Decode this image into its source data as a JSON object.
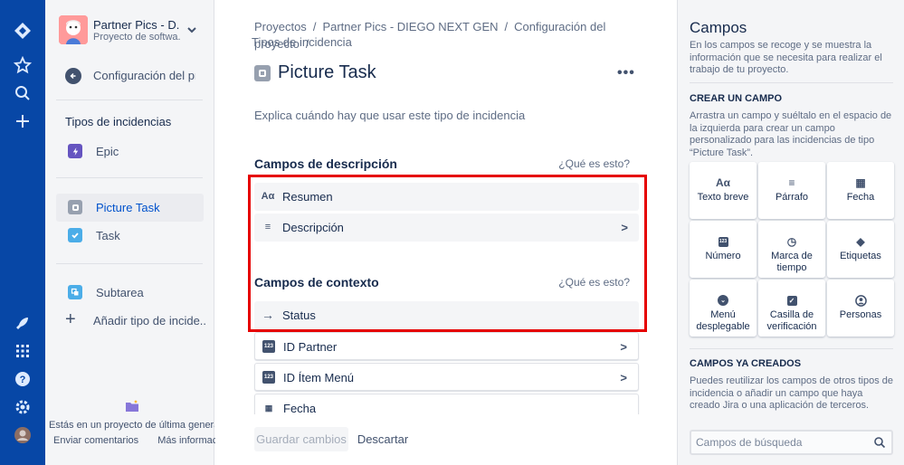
{
  "project": {
    "name": "Partner Pics - D...",
    "type": "Proyecto de softwa..."
  },
  "sidebar": {
    "back_label": "Configuración del pr...",
    "section_title": "Tipos de incidencias",
    "items": [
      {
        "label": "Epic",
        "icon": "epic-icon",
        "color": "#6554c0"
      },
      {
        "label": "Picture Task",
        "icon": "picture-task-icon",
        "color": "#97a0af",
        "active": true
      },
      {
        "label": "Task",
        "icon": "task-icon",
        "color": "#4bade8"
      },
      {
        "label": "Subtarea",
        "icon": "subtask-icon",
        "color": "#4bade8"
      }
    ],
    "add_type_label": "Añadir tipo de incide...",
    "next_gen_text": "Estás en un proyecto de última generación",
    "feedback_link": "Enviar comentarios",
    "more_info_link": "Más información"
  },
  "breadcrumbs": [
    "Proyectos",
    "Partner Pics - DIEGO NEXT GEN",
    "Configuración del proyecto",
    "Tipos de incidencia"
  ],
  "page": {
    "title": "Picture Task",
    "more_icon": "•••",
    "description_placeholder": "Explica cuándo hay que usar este tipo de incidencia"
  },
  "description_fields": {
    "title": "Campos de descripción",
    "help": "¿Qué es esto?",
    "fields": [
      {
        "label": "Resumen",
        "icon": "Aα"
      },
      {
        "label": "Descripción",
        "icon": "≡"
      }
    ]
  },
  "context_fields": {
    "title": "Campos de contexto",
    "help": "¿Qué es esto?",
    "fields": [
      {
        "label": "Status",
        "icon": "→"
      },
      {
        "label": "ID Partner",
        "icon": "123"
      },
      {
        "label": "ID Ítem Menú",
        "icon": "123"
      },
      {
        "label": "Fecha",
        "icon": "📅"
      }
    ]
  },
  "actions": {
    "save_label": "Guardar cambios",
    "cancel_label": "Descartar"
  },
  "right_panel": {
    "title": "Campos",
    "description": "En los campos se recoge y se muestra la información que se necesita para realizar el trabajo de tu proyecto.",
    "create_title": "CREAR UN CAMPO",
    "create_desc": "Arrastra un campo y suéltalo en el espacio de la izquierda para crear un campo personalizado para las incidencias de tipo “Picture Task”.",
    "tiles": [
      {
        "label": "Texto breve",
        "icon": "Aα"
      },
      {
        "label": "Párrafo",
        "icon": "≡"
      },
      {
        "label": "Fecha",
        "icon": "▦"
      },
      {
        "label": "Número",
        "icon": "123"
      },
      {
        "label": "Marca de tiempo",
        "icon": "◷"
      },
      {
        "label": "Etiquetas",
        "icon": "◆"
      },
      {
        "label": "Menú desplegable",
        "icon": "⌄"
      },
      {
        "label": "Casilla de verificación",
        "icon": "✓"
      },
      {
        "label": "Personas",
        "icon": "👤"
      }
    ],
    "existing_title": "CAMPOS YA CREADOS",
    "existing_desc": "Puedes reutilizar los campos de otros tipos de incidencia o añadir un campo que haya creado Jira o una aplicación de terceros.",
    "search_placeholder": "Campos de búsqueda"
  }
}
